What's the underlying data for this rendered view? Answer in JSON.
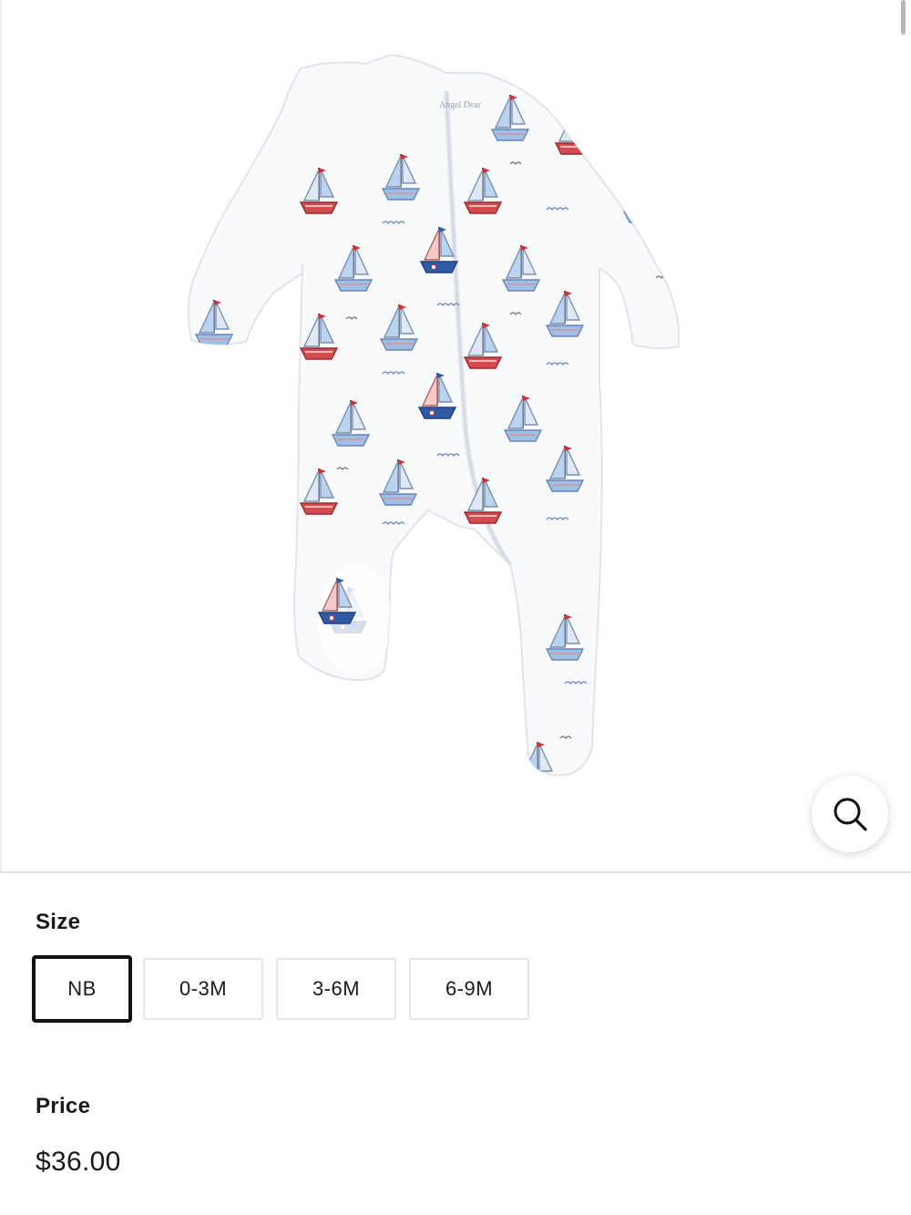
{
  "product_image": {
    "alt": "",
    "brand_tag": "Angel Dear"
  },
  "zoom": {
    "icon": "search-icon"
  },
  "size": {
    "label": "Size",
    "options": [
      "NB",
      "0-3M",
      "3-6M",
      "6-9M"
    ],
    "selected": "NB"
  },
  "price": {
    "label": "Price",
    "value": "$36.00"
  },
  "colors": {
    "selected_border": "#111111",
    "option_border": "#e6e6e6",
    "boat_blue": "#9fc0e6",
    "boat_navy": "#2f5aa8",
    "boat_red": "#c8323a"
  }
}
